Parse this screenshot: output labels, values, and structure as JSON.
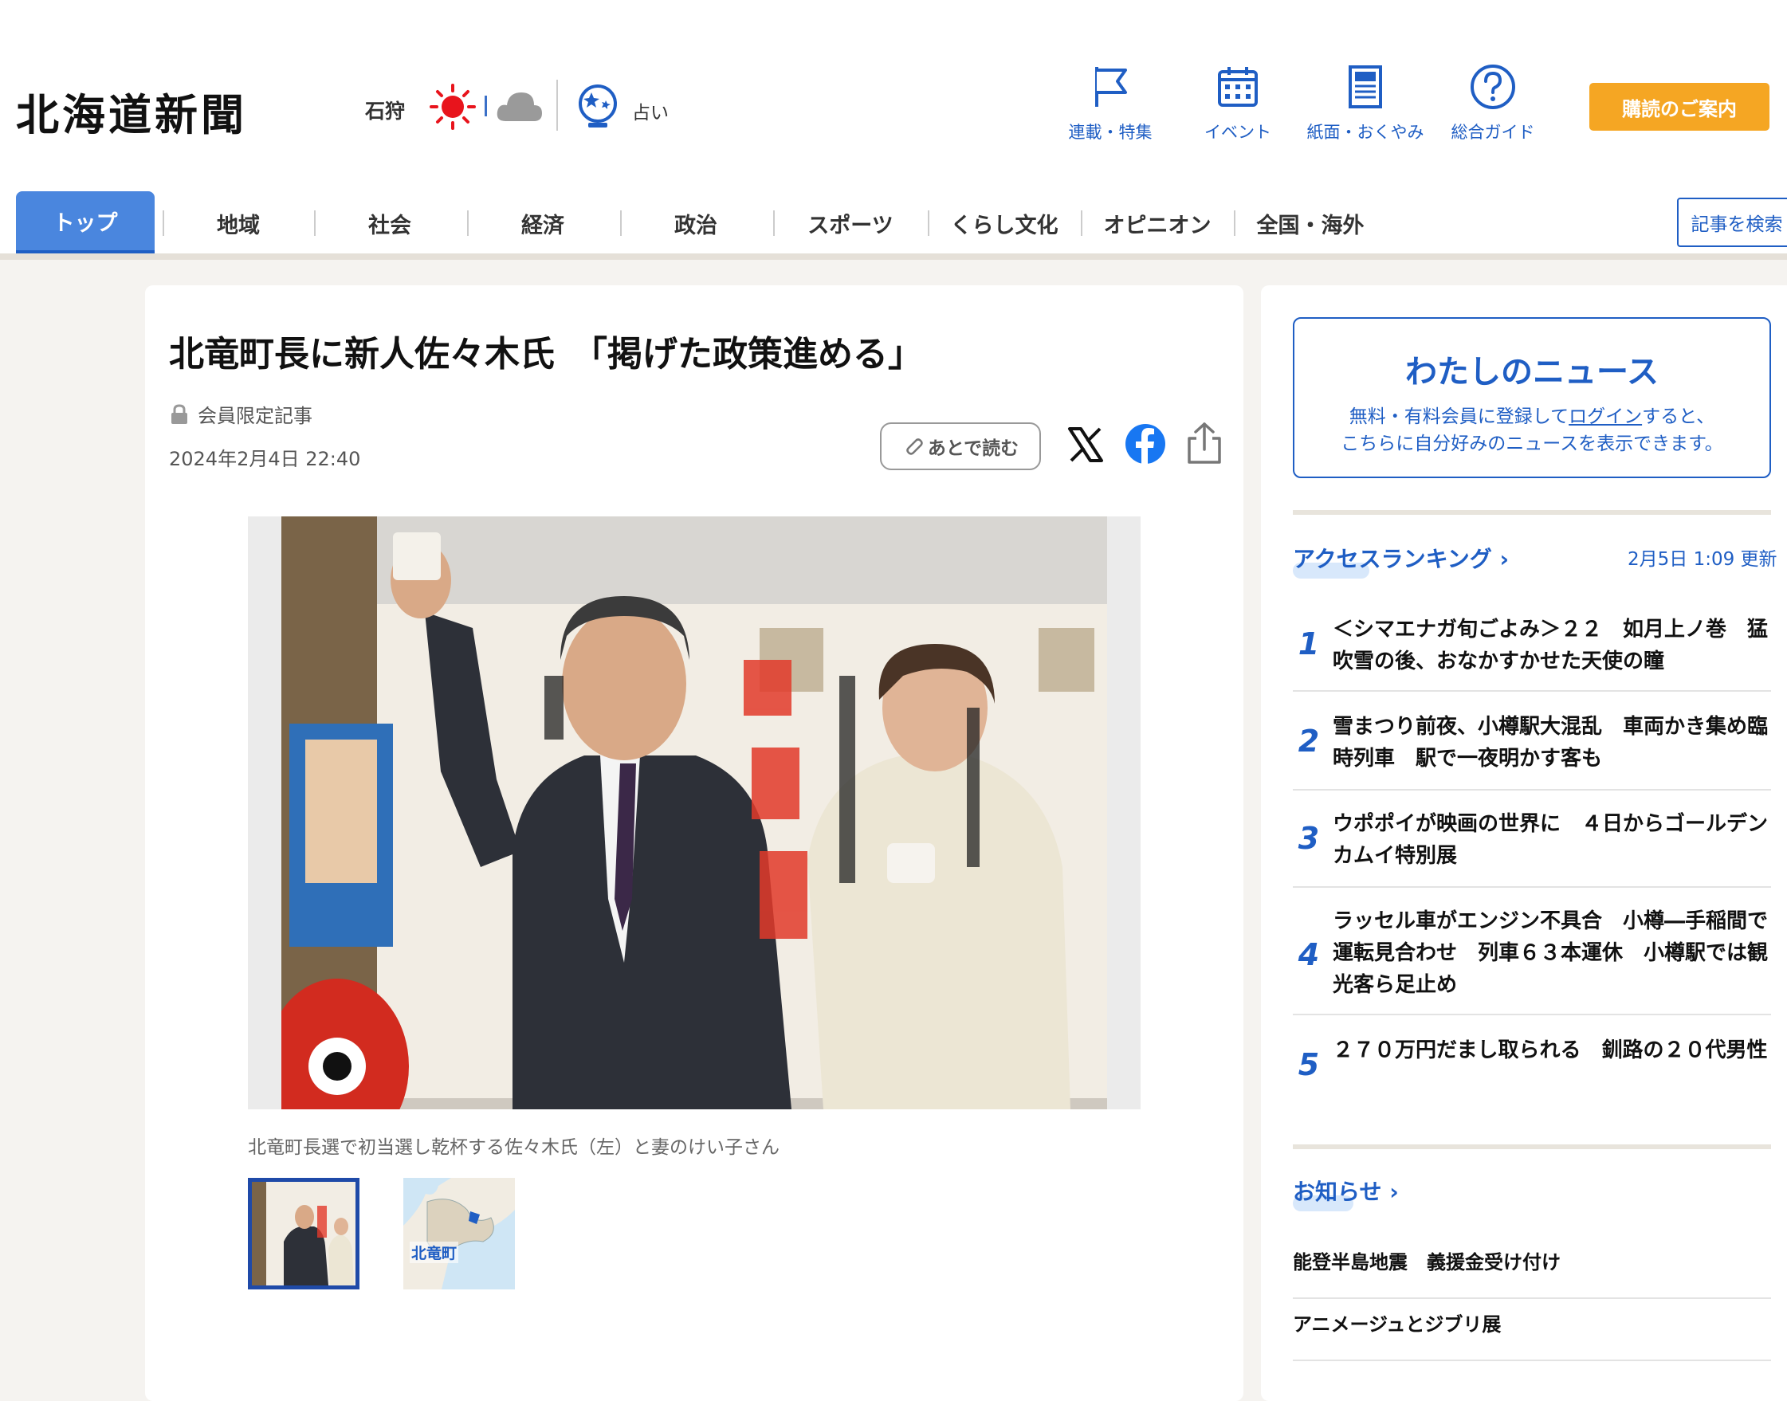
{
  "header": {
    "logo": "北海道新聞",
    "region": "石狩",
    "fortune_label": "占い",
    "quick_links": [
      {
        "label": "連載・特集",
        "icon": "flag-icon"
      },
      {
        "label": "イベント",
        "icon": "calendar-icon"
      },
      {
        "label": "紙面・おくやみ",
        "icon": "newspaper-icon"
      },
      {
        "label": "総合ガイド",
        "icon": "help-icon"
      }
    ],
    "subscribe_label": "購読のご案内"
  },
  "nav": {
    "tabs": [
      "トップ",
      "地域",
      "社会",
      "経済",
      "政治",
      "スポーツ",
      "くらし文化",
      "オピニオン",
      "全国・海外"
    ],
    "search_label": "記事を検索"
  },
  "article": {
    "title": "北竜町長に新人佐々木氏　「掲げた政策進める」",
    "member_label": "会員限定記事",
    "date": "2024年2月4日 22:40",
    "read_later_label": "あとで読む",
    "caption": "北竜町長選で初当選し乾杯する佐々木氏（左）と妻のけい子さん",
    "map_label": "北竜町"
  },
  "sidebar": {
    "mynews": {
      "title": "わたしのニュース",
      "desc_before": "無料・有料会員に登録して",
      "desc_link": "ログイン",
      "desc_after": "すると、",
      "desc_line2": "こちらに自分好みのニュースを表示できます。"
    },
    "ranking": {
      "heading": "アクセスランキング",
      "updated": "2月5日 1:09 更新",
      "items": [
        {
          "rank": "1",
          "title": "＜シマエナガ旬ごよみ＞２２　如月上ノ巻　猛吹雪の後、おなかすかせた天使の瞳"
        },
        {
          "rank": "2",
          "title": "雪まつり前夜、小樽駅大混乱　車両かき集め臨時列車　駅で一夜明かす客も"
        },
        {
          "rank": "3",
          "title": "ウポポイが映画の世界に　４日からゴールデンカムイ特別展"
        },
        {
          "rank": "4",
          "title": "ラッセル車がエンジン不具合　小樽―手稲間で運転見合わせ　列車６３本運休　小樽駅では観光客ら足止め"
        },
        {
          "rank": "5",
          "title": "２７０万円だまし取られる　釧路の２０代男性"
        }
      ]
    },
    "notices": {
      "heading": "お知らせ",
      "items": [
        "能登半島地震　義援金受け付け",
        "アニメージュとジブリ展"
      ]
    }
  },
  "colors": {
    "brand_blue": "#1f5ec4",
    "accent_orange": "#f5a623",
    "nav_active": "#4a86de"
  }
}
